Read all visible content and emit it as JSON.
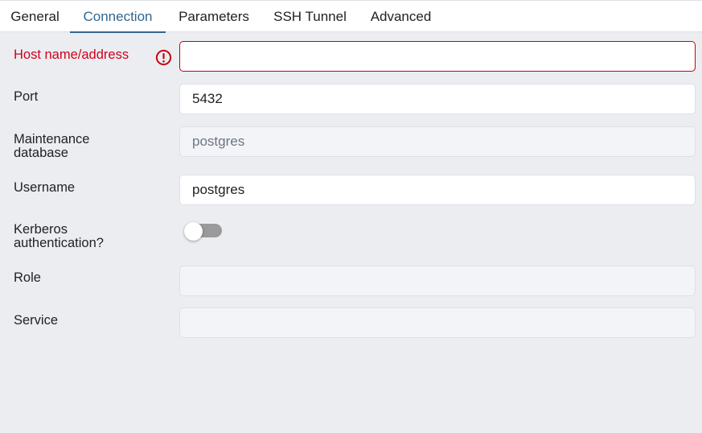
{
  "tabs": [
    {
      "label": "General"
    },
    {
      "label": "Connection",
      "active": true
    },
    {
      "label": "Parameters"
    },
    {
      "label": "SSH Tunnel"
    },
    {
      "label": "Advanced"
    }
  ],
  "form": {
    "host": {
      "label": "Host name/address",
      "value": "",
      "error": true
    },
    "port": {
      "label": "Port",
      "value": "5432"
    },
    "maintenance_db": {
      "label_line1": "Maintenance",
      "label_line2": "database",
      "value": "postgres",
      "disabled": true
    },
    "username": {
      "label": "Username",
      "value": "postgres"
    },
    "kerberos": {
      "label_line1": "Kerberos",
      "label_line2": "authentication?",
      "enabled": false
    },
    "role": {
      "label": "Role",
      "value": "",
      "disabled": true
    },
    "service": {
      "label": "Service",
      "value": "",
      "disabled": true
    }
  },
  "colors": {
    "accent": "#326690",
    "error": "#d0021b",
    "background": "#ebedf1",
    "toggle_off": "#9a9a9a"
  },
  "icons": {
    "error": "exclamation-circle-icon"
  }
}
